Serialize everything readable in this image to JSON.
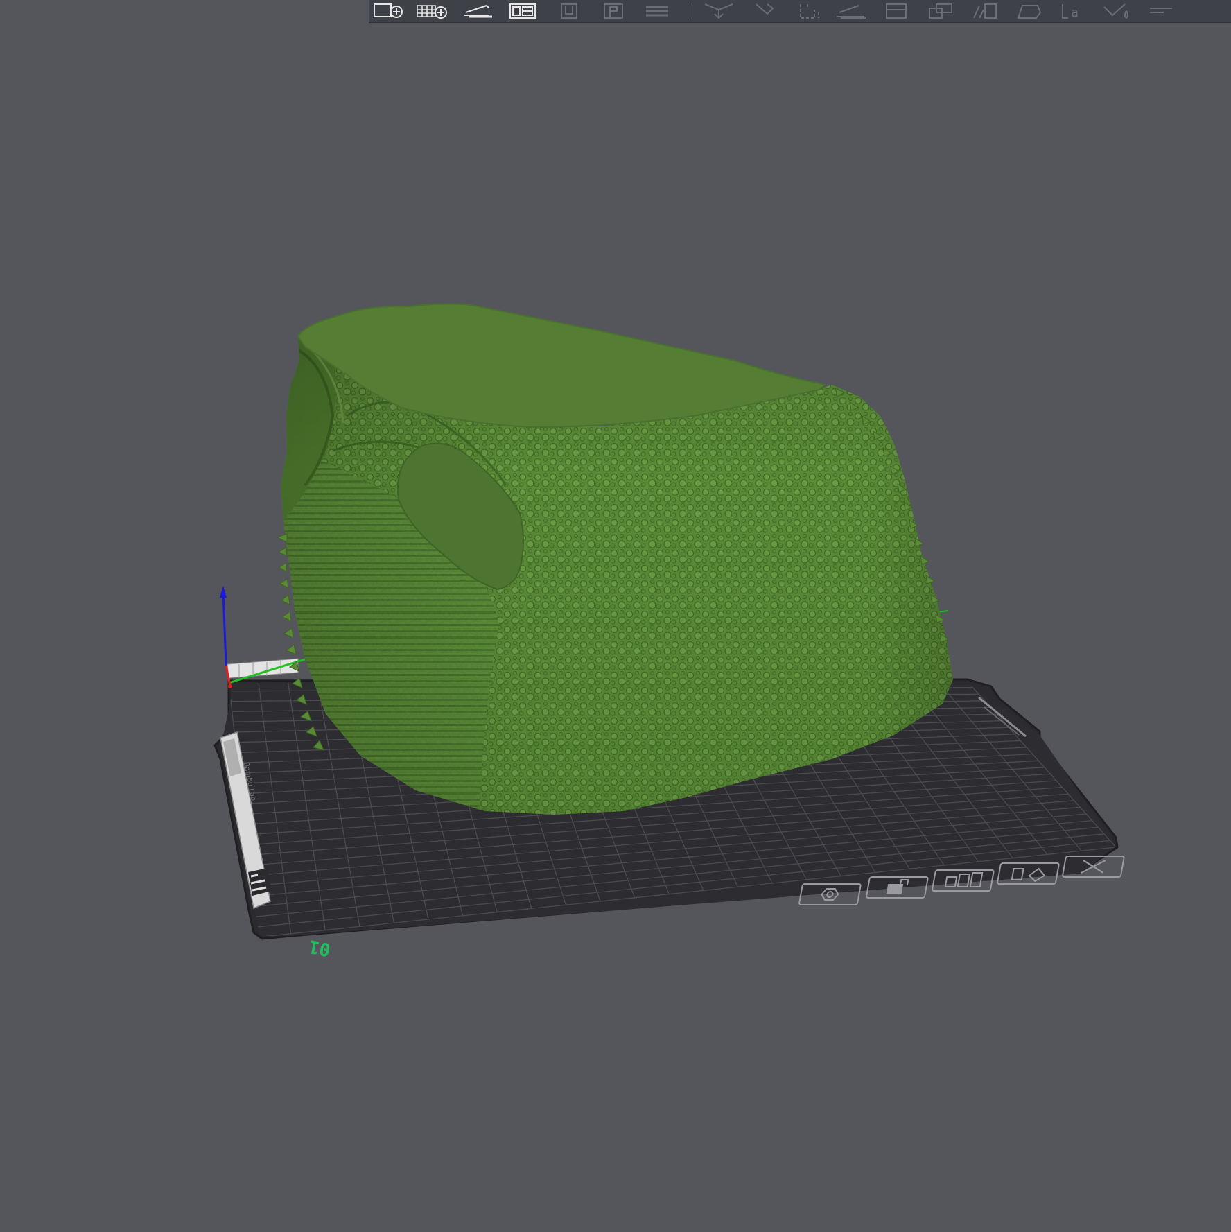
{
  "viewport": {
    "background": "#55555c",
    "plate_color": "#2b2b2f",
    "grid_color": "#4a4a50",
    "model_color": "#5a8a36",
    "model_top_color": "#557d33",
    "plate_number": "01",
    "plate_number_color": "#1fbf5f"
  },
  "axes": {
    "x_color": "#e02020",
    "y_color": "#20c020",
    "z_color": "#1a1ad8"
  },
  "toolbar": {
    "background": "#3f4148",
    "groups": [
      {
        "icons": [
          "add-object-icon",
          "add-plate-icon",
          "auto-orient-icon",
          "arrange-icon"
        ],
        "enabled": true
      },
      {
        "icons": [
          "split-objects-icon",
          "split-parts-icon",
          "layers-icon"
        ],
        "enabled": false
      },
      {
        "icons": [
          "move-icon",
          "rotate-icon",
          "scale-icon",
          "lay-on-face-icon",
          "cut-icon",
          "mesh-boolean-icon",
          "support-paint-icon",
          "seam-paint-icon",
          "text-icon",
          "color-paint-icon",
          "assembly-icon"
        ],
        "enabled": false
      }
    ]
  },
  "plate_controls": [
    {
      "name": "plate-settings-icon"
    },
    {
      "name": "lock-plate-icon"
    },
    {
      "name": "arrange-plate-icon"
    },
    {
      "name": "auto-orient-plate-icon"
    },
    {
      "name": "delete-plate-icon"
    }
  ],
  "plate_label": {
    "brand": "Bambu Lab"
  }
}
